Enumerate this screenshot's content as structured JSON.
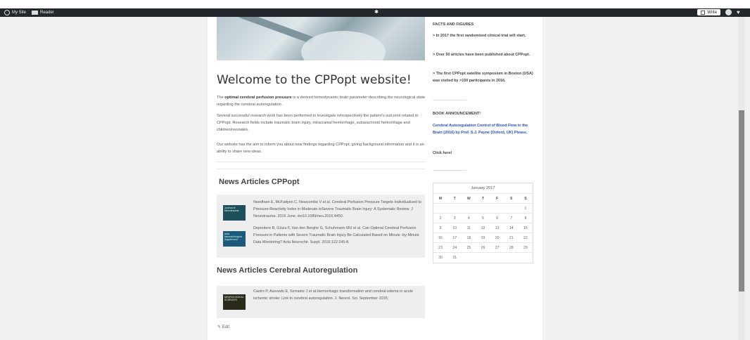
{
  "adminbar": {
    "my_site": "My Site",
    "reader": "Reader",
    "write": "Write"
  },
  "main": {
    "welcome_title": "Welcome to the CPPopt website!",
    "intro_bold": "optimal cerebral perfusion pressure",
    "intro_prefix": "The",
    "intro_rest": "is a derived hemodynamic brain parameter describing the neurological state regarding the cerebral autoregulation.",
    "para2": "Several successful research work has been performed to investigate retrospectively the patient's outcome related to CPPopt. Research fields include traumatic brain injury, intracranial hemorrhage, subarachnoid hemorrhage and children/neonates.",
    "para3": "Our website has the aim to inform you about new findings regarding CPPopt, giving background information and it is an ability to share new ideas.",
    "news_title": "News Articles CPPopt",
    "articles": [
      {
        "thumb": "Journal of Neurotrauma",
        "text": "Needham E, McFadyen C, Newcombe V et al. Cerebral Perfusion Pressure Targets Individualized to Pressure-Reactivity Index in Moderate toSevere Traumatic Brain Injury: A Systematic Review. J Neurotrauma. 2016 June; doi10.1089/neu.2016.4450."
      },
      {
        "thumb": "Acta Neurochirurgica Supplement",
        "text": "Depreitere B, Güiza F, Van den Berghe G, Schuhmann MU et al. Can Optimal Cerebral Perfusion Pressure in Patients with Severe Traumatic Brain Injury Be Calculated Based on Minute -by-Minute Data Monitoring? Acta Neurochir. Suppl. 2016;122:245-8."
      }
    ],
    "news_title2": "News Articles Cerebral Autoregulation",
    "articles2": [
      {
        "thumb": "NEUROLOGICAL SCIENCES",
        "text": "Castro P, Azevedo E, Serrador J et al.Hemorrhagic transformation and cerebral edema in acute ischemic stroke: Link to cerebral autoregulation. J. Neurol. Sci. September 2016;"
      }
    ],
    "edit": "Edit"
  },
  "sidebar": {
    "facts_head": "FACTS AND FIGURES",
    "facts": [
      "> In 2017 the first randomised clinical trial will start.",
      "> Over 50 articles have been published about CPPopt.",
      "> The first CPPopt satellite symposium in Boston (USA) was visited by >150 participants in 2016."
    ],
    "book_head": "BOOK ANNOUNCEMENT!",
    "book_link": "Cerebral Autoregulation Control of Blood Flow in the Brain (2016) by Prof. S.J. Payne (Oxford, UK) Please,",
    "click_here": "Click here!",
    "calendar": {
      "caption": "January 2017",
      "days": [
        "M",
        "T",
        "W",
        "T",
        "F",
        "S",
        "S"
      ],
      "weeks": [
        [
          "",
          "",
          "",
          "",
          "",
          "",
          "1"
        ],
        [
          "2",
          "3",
          "4",
          "5",
          "6",
          "7",
          "8"
        ],
        [
          "9",
          "10",
          "11",
          "12",
          "13",
          "14",
          "15"
        ],
        [
          "16",
          "17",
          "18",
          "19",
          "20",
          "21",
          "22"
        ],
        [
          "23",
          "24",
          "25",
          "26",
          "27",
          "28",
          "29"
        ],
        [
          "30",
          "31",
          "",
          "",
          "",
          "",
          ""
        ]
      ]
    }
  },
  "colors": {
    "adminbar_bg": "#23282d",
    "link_blue": "#2a4fc7",
    "page_bg": "#f1f1f1"
  }
}
